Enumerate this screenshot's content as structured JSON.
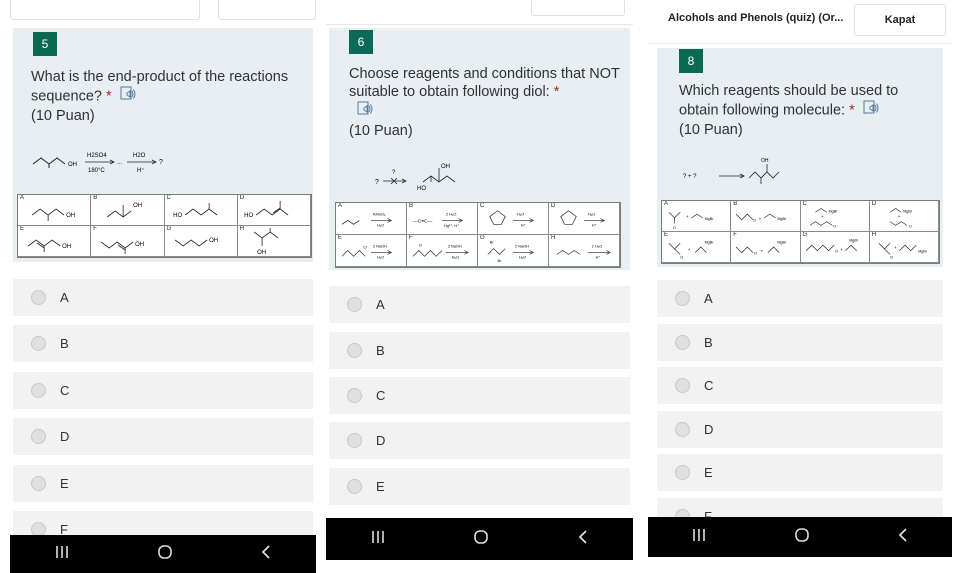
{
  "panel1": {
    "number": "5",
    "question": "What is the end-product of the reactions sequence?",
    "required_mark": "*",
    "points": "(10 Puan)",
    "scheme": {
      "reagent1": "H2SO4",
      "cond1": "180°C",
      "reagent2": "H2O",
      "cond2": "H⁺",
      "result": "?"
    },
    "grid_labels": [
      "A",
      "B",
      "C",
      "D",
      "E",
      "F",
      "G",
      "H"
    ],
    "options": [
      "A",
      "B",
      "C",
      "D",
      "E",
      "F"
    ]
  },
  "panel2": {
    "number": "6",
    "question": "Choose reagents and conditions that NOT suitable to obtain following diol:",
    "required_mark": "*",
    "points": "(10 Puan)",
    "scheme": {
      "start": "?",
      "over_arrow": "?"
    },
    "grid_labels": [
      "A",
      "B",
      "C",
      "D",
      "E",
      "F",
      "G",
      "H"
    ],
    "options": [
      "A",
      "B",
      "C",
      "D",
      "E"
    ]
  },
  "panel3": {
    "header_title": "Alcohols and Phenols (quiz) (Or...",
    "close_label": "Kapat",
    "number": "8",
    "question": "Which reagents should be used to obtain following molecule:",
    "required_mark": "*",
    "points": "(10 Puan)",
    "scheme": {
      "text": "? + ?"
    },
    "grid_labels": [
      "A",
      "B",
      "C",
      "D",
      "E",
      "F",
      "G",
      "H"
    ],
    "options": [
      "A",
      "B",
      "C",
      "D",
      "E",
      "F"
    ]
  },
  "navbar": {
    "recent": "|||",
    "home": "O",
    "back": "<"
  },
  "colors": {
    "accent": "#0b6a55",
    "card": "#e7eff3",
    "option_bg": "#f2f2f2",
    "required": "#a4262c"
  }
}
